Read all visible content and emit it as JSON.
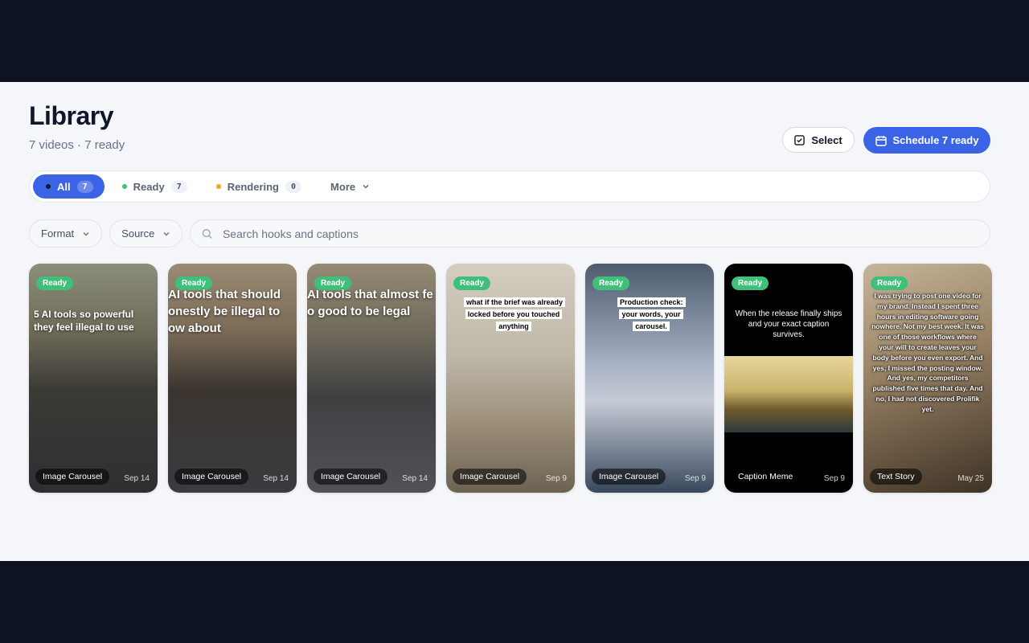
{
  "page": {
    "title": "Library",
    "subtitle": "7 videos · 7 ready"
  },
  "actions": {
    "select_label": "Select",
    "schedule_label": "Schedule 7 ready"
  },
  "tabs": [
    {
      "label": "All",
      "count": "7",
      "dot_color": "#0f172a",
      "active": true
    },
    {
      "label": "Ready",
      "count": "7",
      "dot_color": "#3fbf79",
      "active": false
    },
    {
      "label": "Rendering",
      "count": "0",
      "dot_color": "#f0a41b",
      "active": false
    },
    {
      "label": "More",
      "active": false
    }
  ],
  "filters": {
    "format_label": "Format",
    "source_label": "Source",
    "search_placeholder": "Search hooks and captions"
  },
  "cards": [
    {
      "status": "Ready",
      "overlay": "5 AI tools so powerful they feel illegal to use",
      "format": "Image Carousel",
      "date": "Sep 14"
    },
    {
      "status": "Ready",
      "overlay": "AI tools that should onestly be illegal to ow about",
      "format": "Image Carousel",
      "date": "Sep 14"
    },
    {
      "status": "Ready",
      "overlay": "AI tools that almost fe o good to be legal",
      "format": "Image Carousel",
      "date": "Sep 14"
    },
    {
      "status": "Ready",
      "overlay": "what if the brief was already locked before you touched anything",
      "format": "Image Carousel",
      "date": "Sep 9"
    },
    {
      "status": "Ready",
      "overlay": "Production check: your words, your carousel.",
      "format": "Image Carousel",
      "date": "Sep 9"
    },
    {
      "status": "Ready",
      "overlay": "When the release finally ships and your exact caption survives.",
      "format": "Caption Meme",
      "date": "Sep 9"
    },
    {
      "status": "Ready",
      "overlay": "I was trying to post one video for my brand. Instead I spent three hours in editing software going nowhere. Not my best week. It was one of those workflows where your will to create leaves your body before you even export. And yes, I missed the posting window. And yes, my competitors published five times that day. And no, I had not discovered Prolifik yet.",
      "format": "Text Story",
      "date": "May 25"
    }
  ],
  "colors": {
    "accent": "#3b63e6",
    "ready": "#3fbf79",
    "rendering": "#f0a41b"
  }
}
